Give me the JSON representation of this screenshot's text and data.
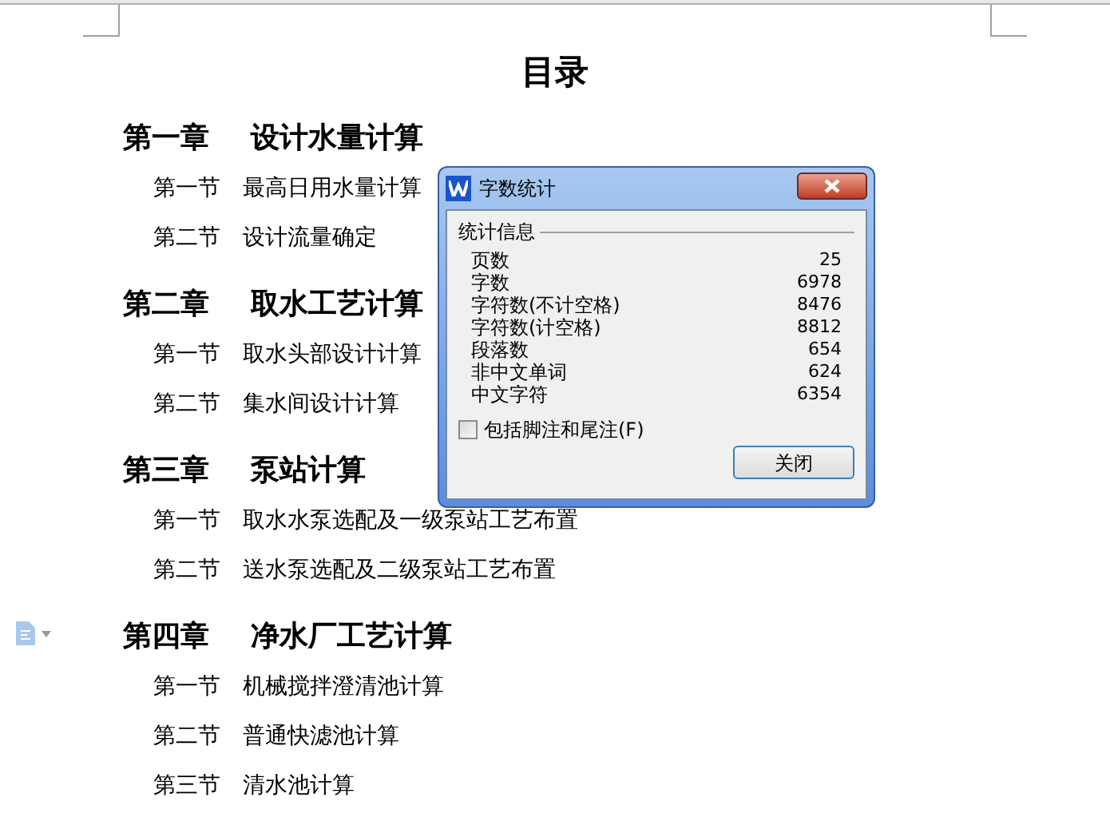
{
  "document": {
    "title": "目录",
    "chapters": [
      {
        "number": "第一章",
        "title": "设计水量计算",
        "sections": [
          {
            "number": "第一节",
            "title": "最高日用水量计算"
          },
          {
            "number": "第二节",
            "title": "设计流量确定"
          }
        ]
      },
      {
        "number": "第二章",
        "title": "取水工艺计算",
        "sections": [
          {
            "number": "第一节",
            "title": "取水头部设计计算"
          },
          {
            "number": "第二节",
            "title": "集水间设计计算"
          }
        ]
      },
      {
        "number": "第三章",
        "title": "泵站计算",
        "sections": [
          {
            "number": "第一节",
            "title": "取水水泵选配及一级泵站工艺布置"
          },
          {
            "number": "第二节",
            "title": "送水泵选配及二级泵站工艺布置"
          }
        ]
      },
      {
        "number": "第四章",
        "title": "净水厂工艺计算",
        "sections": [
          {
            "number": "第一节",
            "title": "机械搅拌澄清池计算"
          },
          {
            "number": "第二节",
            "title": "普通快滤池计算"
          },
          {
            "number": "第三节",
            "title": "清水池计算"
          }
        ]
      }
    ]
  },
  "dialog": {
    "title": "字数统计",
    "group_label": "统计信息",
    "stats": [
      {
        "label": "页数",
        "value": "25"
      },
      {
        "label": "字数",
        "value": "6978"
      },
      {
        "label": "字符数(不计空格)",
        "value": "8476"
      },
      {
        "label": "字符数(计空格)",
        "value": "8812"
      },
      {
        "label": "段落数",
        "value": "654"
      },
      {
        "label": "非中文单词",
        "value": "624"
      },
      {
        "label": "中文字符",
        "value": "6354"
      }
    ],
    "checkbox": {
      "label": "包括脚注和尾注(F)",
      "checked": false
    },
    "close_button": "关闭"
  }
}
